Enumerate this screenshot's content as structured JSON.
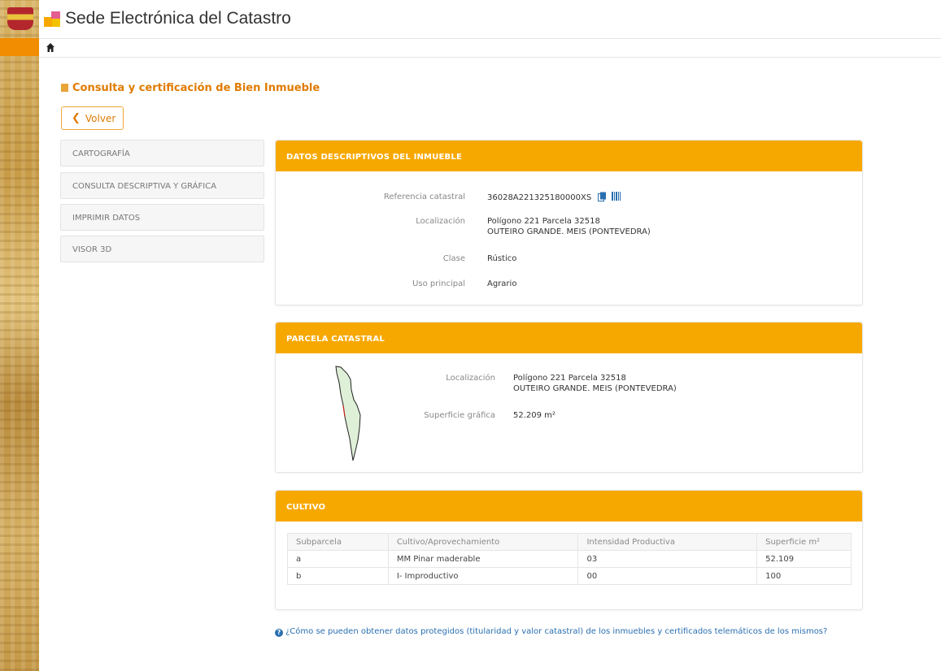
{
  "header": {
    "title": "Sede Electrónica del Catastro"
  },
  "nav": {
    "home_icon": "home-icon"
  },
  "page": {
    "heading": "Consulta y certificación de Bien Inmueble",
    "back_label": "Volver"
  },
  "sidebar": {
    "items": [
      {
        "label": "CARTOGRAFÍA"
      },
      {
        "label": "CONSULTA DESCRIPTIVA Y GRÁFICA"
      },
      {
        "label": "IMPRIMIR DATOS"
      },
      {
        "label": "VISOR 3D"
      }
    ]
  },
  "descriptive": {
    "title": "DATOS DESCRIPTIVOS DEL INMUEBLE",
    "ref_label": "Referencia catastral",
    "ref_value": "36028A221325180000XS",
    "loc_label": "Localización",
    "loc_line1": "Polígono 221 Parcela 32518",
    "loc_line2": "OUTEIRO GRANDE. MEIS (PONTEVEDRA)",
    "clase_label": "Clase",
    "clase_value": "Rústico",
    "uso_label": "Uso principal",
    "uso_value": "Agrario"
  },
  "parcela": {
    "title": "PARCELA CATASTRAL",
    "loc_label": "Localización",
    "loc_line1": "Polígono 221 Parcela 32518",
    "loc_line2": "OUTEIRO GRANDE. MEIS (PONTEVEDRA)",
    "sup_label": "Superficie gráfica",
    "sup_value": "52.209 m²",
    "shape_color": "#dff0d8"
  },
  "cultivo": {
    "title": "CULTIVO",
    "headers": [
      "Subparcela",
      "Cultivo/Aprovechamiento",
      "Intensidad Productiva",
      "Superficie m²"
    ],
    "rows": [
      [
        "a",
        "MM Pinar maderable",
        "03",
        "52.109"
      ],
      [
        "b",
        "I- Improductivo",
        "00",
        "100"
      ]
    ]
  },
  "footer": {
    "text": "¿Cómo se pueden obtener datos protegidos (titularidad y valor catastral) de los inmuebles y certificados telemáticos de los mismos?"
  },
  "colors": {
    "accent": "#f7a800",
    "link": "#2a6fb0",
    "orange_text": "#e07b00"
  }
}
